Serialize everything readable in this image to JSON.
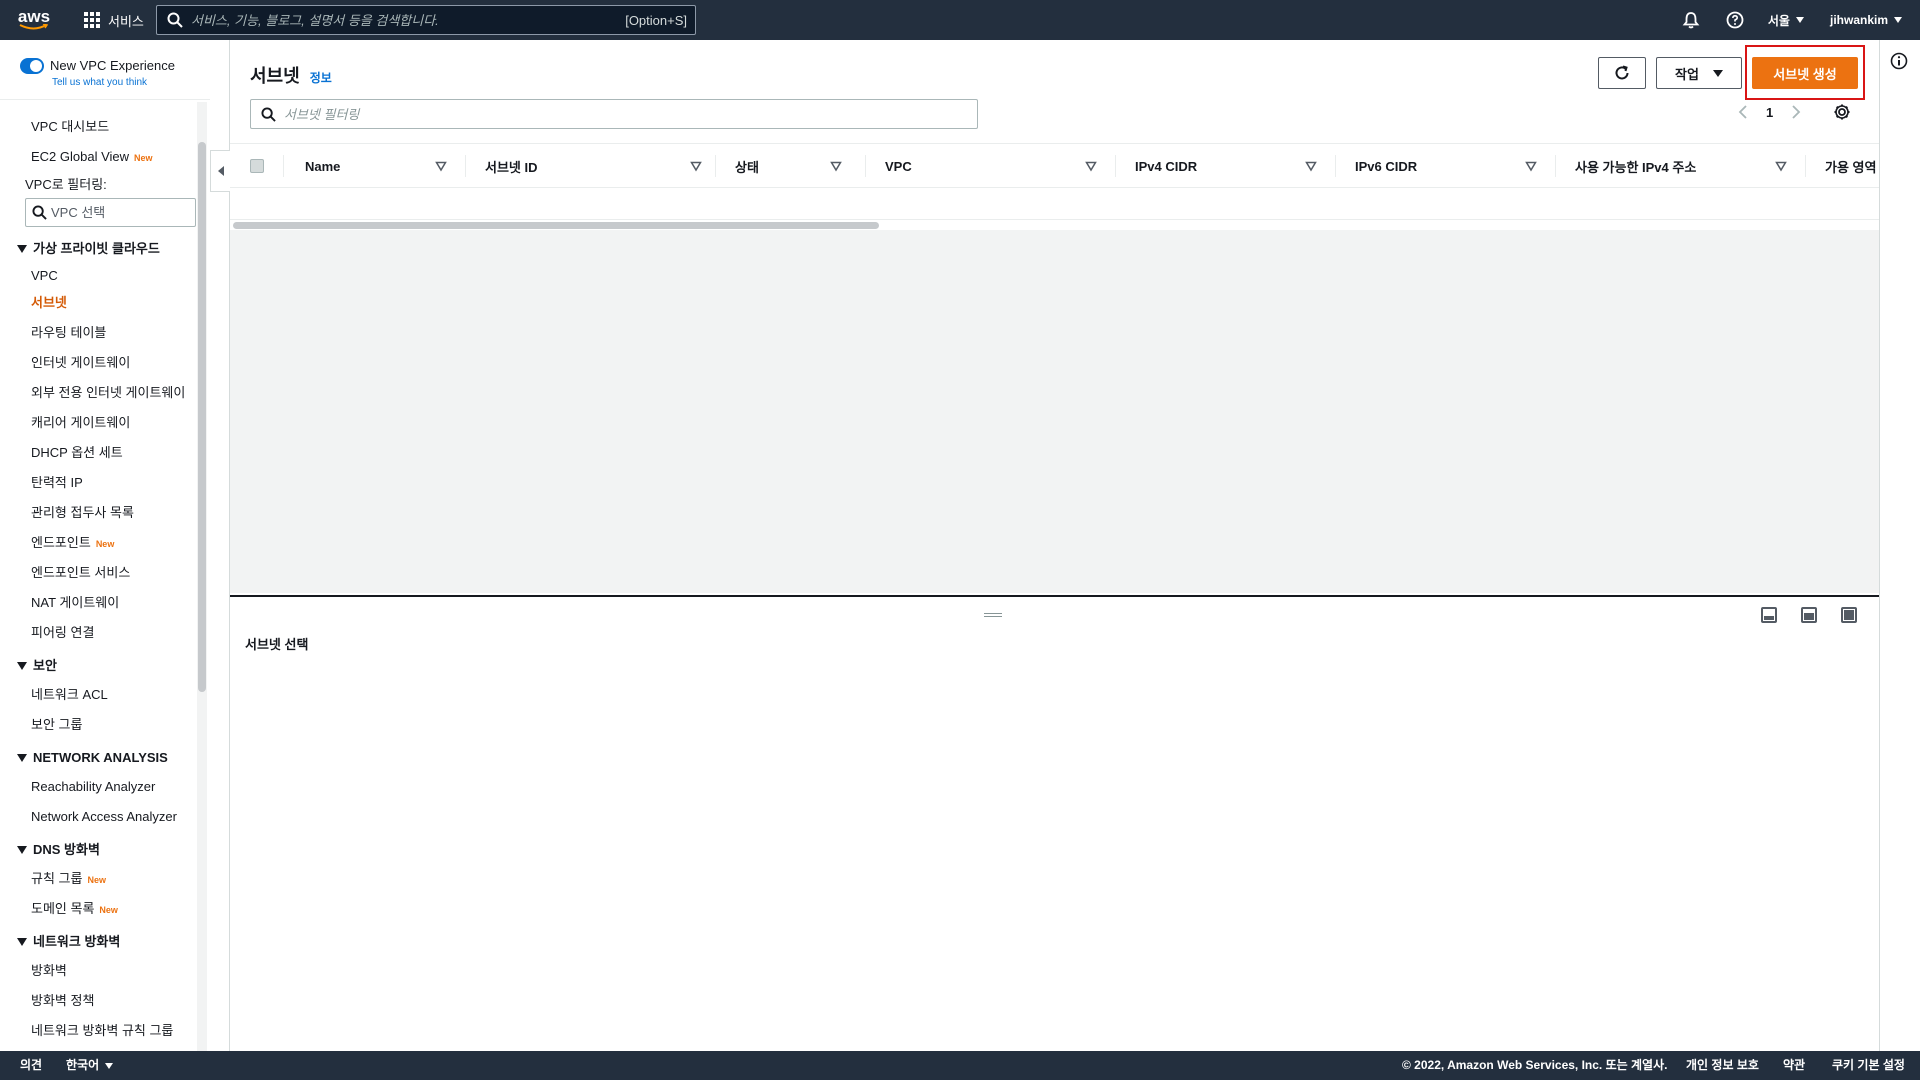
{
  "topnav": {
    "logo": "aws",
    "services_label": "서비스",
    "search_placeholder": "서비스, 기능, 블로그, 설명서 등을 검색합니다.",
    "search_shortcut": "[Option+S]",
    "region": "서울",
    "user": "jihwankim"
  },
  "sidebar": {
    "toggle_label": "New VPC Experience",
    "toggle_sub": "Tell us what you think",
    "top_items": [
      {
        "label": "VPC 대시보드"
      },
      {
        "label": "EC2 Global View",
        "badge": "New"
      }
    ],
    "filter_label": "VPC로 필터링:",
    "filter_placeholder": "VPC 선택",
    "sections": [
      {
        "title": "가상 프라이빗 클라우드",
        "items": [
          "VPC",
          "서브넷",
          "라우팅 테이블",
          "인터넷 게이트웨이",
          "외부 전용 인터넷 게이트웨이",
          "캐리어 게이트웨이",
          "DHCP 옵션 세트",
          "탄력적 IP",
          "관리형 접두사 목록",
          "엔드포인트",
          "엔드포인트 서비스",
          "NAT 게이트웨이",
          "피어링 연결"
        ]
      },
      {
        "title": "보안",
        "items": [
          "네트워크 ACL",
          "보안 그룹"
        ]
      },
      {
        "title": "NETWORK ANALYSIS",
        "items": [
          "Reachability Analyzer",
          "Network Access Analyzer"
        ]
      },
      {
        "title": "DNS 방화벽",
        "items": [
          "규칙 그룹",
          "도메인 목록"
        ]
      },
      {
        "title": "네트워크 방화벽",
        "items": [
          "방화벽",
          "방화벽 정책",
          "네트워크 방화벽 규칙 그룹"
        ]
      }
    ],
    "new_badge": "New"
  },
  "main": {
    "title": "서브넷",
    "info": "정보",
    "actions_label": "작업",
    "create_label": "서브넷 생성",
    "filter_placeholder": "서브넷 필터링",
    "page_number": "1",
    "columns": [
      "Name",
      "서브넷 ID",
      "상태",
      "VPC",
      "IPv4 CIDR",
      "IPv6 CIDR",
      "사용 가능한 IPv4 주소",
      "가용 영역"
    ],
    "detail_title": "서브넷 선택"
  },
  "footer": {
    "feedback": "의견",
    "language": "한국어",
    "copyright": "© 2022, Amazon Web Services, Inc. 또는 계열사.",
    "privacy": "개인 정보 보호",
    "terms": "약관",
    "cookies": "쿠키 기본 설정"
  },
  "colors": {
    "nav_bg": "#232f3e",
    "accent": "#ec7211",
    "active_link": "#d45b07",
    "link": "#0972d3",
    "highlight": "#d91515"
  }
}
